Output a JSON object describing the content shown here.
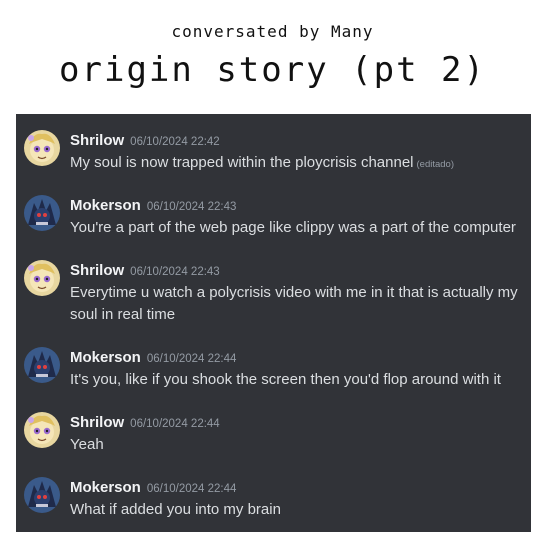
{
  "header": {
    "subtitle": "conversated by Many",
    "title": "origin story (pt 2)"
  },
  "edited_label": "(editado)",
  "messages": [
    {
      "user": "Shrilow",
      "timestamp": "06/10/2024 22:42",
      "text": "My soul is now trapped within the ploycrisis channel",
      "edited": true,
      "avatar": "shrilow-avatar"
    },
    {
      "user": "Mokerson",
      "timestamp": "06/10/2024 22:43",
      "text": "You're a part of the web page like clippy was a part of the computer",
      "edited": false,
      "avatar": "mokerson-avatar"
    },
    {
      "user": "Shrilow",
      "timestamp": "06/10/2024 22:43",
      "text": "Everytime u watch a polycrisis video with me in it that is actually my soul in real time",
      "edited": false,
      "avatar": "shrilow-avatar"
    },
    {
      "user": "Mokerson",
      "timestamp": "06/10/2024 22:44",
      "text": "It's you, like if you shook the screen then you'd flop around with it",
      "edited": false,
      "avatar": "mokerson-avatar"
    },
    {
      "user": "Shrilow",
      "timestamp": "06/10/2024 22:44",
      "text": "Yeah",
      "edited": false,
      "avatar": "shrilow-avatar"
    },
    {
      "user": "Mokerson",
      "timestamp": "06/10/2024 22:44",
      "text": "What if added you into my brain",
      "edited": false,
      "avatar": "mokerson-avatar"
    }
  ],
  "colors": {
    "chat_background": "#313338",
    "username": "#f2f3f5",
    "message_text": "#dbdee1",
    "timestamp": "#949ba4"
  }
}
